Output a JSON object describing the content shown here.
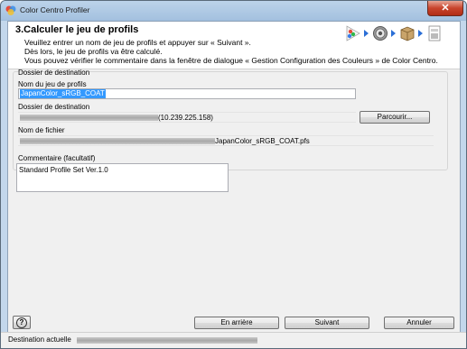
{
  "window": {
    "title": "Color Centro Profiler",
    "close_label": "✕"
  },
  "header": {
    "step_title": "3.Calculer le jeu de profils",
    "instructions": [
      "Veuillez entrer un nom de jeu de profils et appuyer sur « Suivant ».",
      "Dès lors, le jeu de profils va être calculé.",
      "Vous pouvez vérifier le commentaire dans la fenêtre de dialogue « Gestion Configuration des Couleurs » de Color Centro."
    ],
    "workflow_icons": [
      "palette-icon",
      "gear-icon",
      "box-icon",
      "printer-icon"
    ]
  },
  "destination_group": {
    "title": "Dossier de destination",
    "profile_set_name_label": "Nom du jeu de profils",
    "profile_set_name_value": "JapanColor_sRGB_COAT",
    "destination_folder_label": "Dossier de destination",
    "destination_folder_value": "(10.239.225.158)",
    "browse_button": "Parcourir...",
    "file_name_label": "Nom de fichier",
    "file_name_value": "JapanColor_sRGB_COAT.pfs"
  },
  "comment": {
    "label": "Commentaire (facultatif)",
    "value": "Standard Profile Set Ver.1.0"
  },
  "footer": {
    "help_label": "?",
    "back_button": "En arrière",
    "next_button": "Suivant",
    "cancel_button": "Annuler"
  },
  "status": {
    "label": "Destination actuelle"
  }
}
